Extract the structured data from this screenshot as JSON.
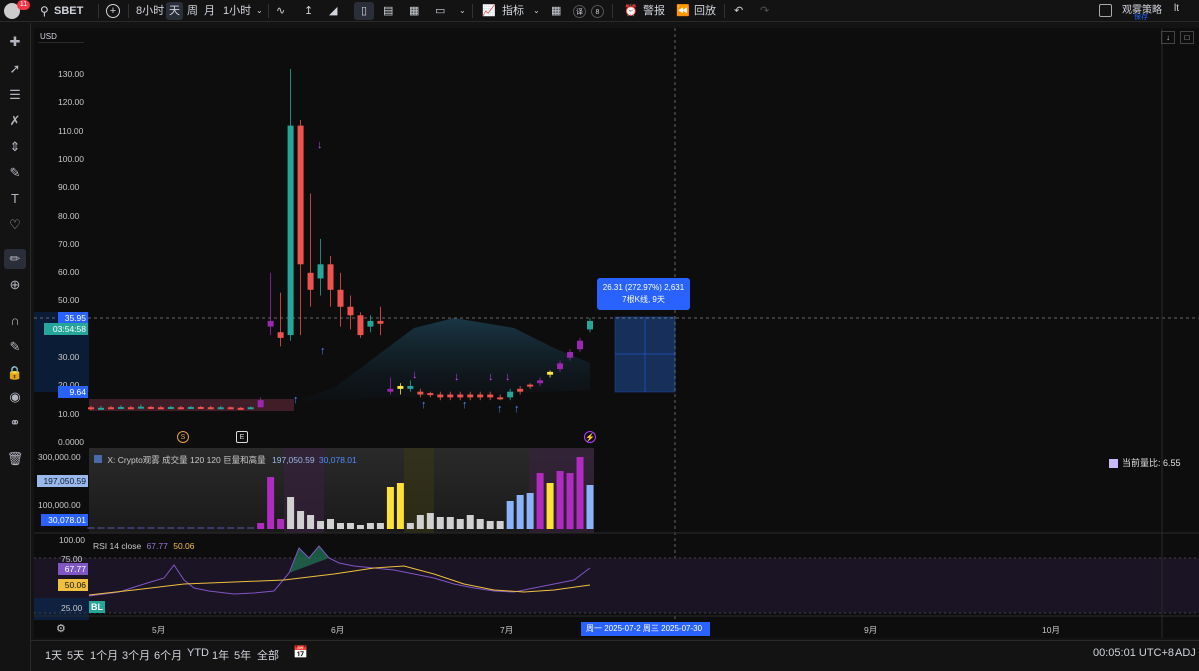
{
  "topbar": {
    "avatar_badge": "11",
    "symbol": "SBET",
    "add": "+",
    "intervals": [
      "8小时",
      "天",
      "周",
      "月",
      "1小时"
    ],
    "active_interval": "天",
    "indicators_label": "指标",
    "alerts_label": "警报",
    "replay_label": "回放",
    "layout_name": "观雾策略",
    "layout_sub": "保存",
    "small_badge_1": "译",
    "small_badge_2": "8"
  },
  "chart": {
    "currency": "USD",
    "price_ticks": [
      "130.00",
      "120.00",
      "110.00",
      "100.00",
      "90.00",
      "80.00",
      "70.00",
      "60.00",
      "50.00",
      "40.00",
      "30.00",
      "20.00",
      "10.00",
      "0.0000"
    ],
    "current_price_tag": "35.95",
    "countdown_tag": "03:54:58",
    "low_tag": "9.64",
    "measure_line1": "26.31 (272.97%) 2,631",
    "measure_line2": "7根K线, 9天",
    "event_s": "S",
    "event_e": "E",
    "volume_title": "X: Crypto观雾 成交量 120 120 巨量和高量",
    "volume_val1": "197,050.59",
    "volume_val2": "30,078.01",
    "volume_ticks": [
      "300,000.00",
      "100,000.00"
    ],
    "volume_tag1": "197,050.59",
    "volume_tag2": "30,078.01",
    "volume_ratio": "当前量比: 6.55",
    "rsi_title": "RSI 14 close",
    "rsi_val1": "67.77",
    "rsi_val2": "50.06",
    "rsi_ticks": [
      "100.00",
      "75.00",
      "25.00"
    ],
    "rsi_tag1": "67.77",
    "rsi_tag2": "50.06",
    "rsi_bl": "BL",
    "time_ticks": [
      "5月",
      "6月",
      "7月",
      "9月",
      "10月"
    ],
    "time_tag": "周一 2025-07-2 周三 2025-07-30"
  },
  "bottombar": {
    "ranges": [
      "1天",
      "5天",
      "1个月",
      "3个月",
      "6个月",
      "YTD",
      "1年",
      "5年",
      "全部"
    ],
    "clock": "00:05:01 UTC+8",
    "adj": "ADJ"
  },
  "colors": {
    "up": "#26a69a",
    "down": "#ef5350",
    "purple": "#9c27b0",
    "blue": "#2962ff",
    "yellow": "#ffeb3b",
    "accent": "#2962ff"
  },
  "chart_data": {
    "type": "candlestick",
    "price_range": [
      0,
      130
    ],
    "candles": [
      {
        "o": 4,
        "c": 4.5,
        "h": 5,
        "l": 3.5,
        "k": "d"
      },
      {
        "o": 4,
        "c": 4.3,
        "h": 5,
        "l": 3.8,
        "k": "u"
      },
      {
        "o": 4.2,
        "c": 4.5,
        "h": 5,
        "l": 4,
        "k": "d"
      },
      {
        "o": 4.5,
        "c": 4.6,
        "h": 5.2,
        "l": 4,
        "k": "u"
      },
      {
        "o": 4.5,
        "c": 4.4,
        "h": 5,
        "l": 4,
        "k": "d"
      },
      {
        "o": 4.5,
        "c": 4.7,
        "h": 5.5,
        "l": 4.2,
        "k": "u"
      },
      {
        "o": 4.6,
        "c": 4.5,
        "h": 5,
        "l": 4.2,
        "k": "d"
      },
      {
        "o": 4.5,
        "c": 4.3,
        "h": 5,
        "l": 4,
        "k": "d"
      },
      {
        "o": 4.3,
        "c": 4.6,
        "h": 5,
        "l": 4,
        "k": "u"
      },
      {
        "o": 4.5,
        "c": 4.4,
        "h": 5,
        "l": 4,
        "k": "d"
      },
      {
        "o": 4.4,
        "c": 4.6,
        "h": 5,
        "l": 4.2,
        "k": "u"
      },
      {
        "o": 4.6,
        "c": 4.5,
        "h": 5,
        "l": 4.2,
        "k": "d"
      },
      {
        "o": 4.5,
        "c": 4.4,
        "h": 5,
        "l": 4.2,
        "k": "d"
      },
      {
        "o": 4.4,
        "c": 4.5,
        "h": 5,
        "l": 4.2,
        "k": "u"
      },
      {
        "o": 4.5,
        "c": 4.3,
        "h": 4.8,
        "l": 4,
        "k": "d"
      },
      {
        "o": 4.3,
        "c": 4.2,
        "h": 4.6,
        "l": 4,
        "k": "d"
      },
      {
        "o": 4.2,
        "c": 4.5,
        "h": 4.8,
        "l": 4,
        "k": "u"
      },
      {
        "o": 4.5,
        "c": 7,
        "h": 8,
        "l": 4.4,
        "k": "p"
      },
      {
        "o": 33,
        "c": 35,
        "h": 52,
        "l": 30,
        "k": "p"
      },
      {
        "o": 31,
        "c": 29,
        "h": 45,
        "l": 26,
        "k": "d"
      },
      {
        "o": 30,
        "c": 104,
        "h": 124,
        "l": 28,
        "k": "u"
      },
      {
        "o": 104,
        "c": 55,
        "h": 106,
        "l": 30,
        "k": "d"
      },
      {
        "o": 52,
        "c": 46,
        "h": 80,
        "l": 40,
        "k": "d"
      },
      {
        "o": 50,
        "c": 55,
        "h": 64,
        "l": 44,
        "k": "u"
      },
      {
        "o": 55,
        "c": 46,
        "h": 58,
        "l": 40,
        "k": "d"
      },
      {
        "o": 46,
        "c": 40,
        "h": 52,
        "l": 33,
        "k": "d"
      },
      {
        "o": 40,
        "c": 37,
        "h": 44,
        "l": 32,
        "k": "d"
      },
      {
        "o": 37,
        "c": 30,
        "h": 38,
        "l": 29,
        "k": "d"
      },
      {
        "o": 33,
        "c": 35,
        "h": 37,
        "l": 31,
        "k": "u"
      },
      {
        "o": 35,
        "c": 34,
        "h": 40,
        "l": 30,
        "k": "d"
      },
      {
        "o": 10,
        "c": 11,
        "h": 15,
        "l": 9,
        "k": "p"
      },
      {
        "o": 11,
        "c": 12,
        "h": 13,
        "l": 9,
        "k": "y"
      },
      {
        "o": 11,
        "c": 12,
        "h": 14,
        "l": 10,
        "k": "u"
      },
      {
        "o": 10,
        "c": 9,
        "h": 11,
        "l": 8,
        "k": "d"
      },
      {
        "o": 9,
        "c": 9.5,
        "h": 10,
        "l": 8,
        "k": "d"
      },
      {
        "o": 9,
        "c": 8,
        "h": 10,
        "l": 7,
        "k": "d"
      },
      {
        "o": 9,
        "c": 8,
        "h": 10,
        "l": 7,
        "k": "d"
      },
      {
        "o": 8,
        "c": 9,
        "h": 10,
        "l": 7,
        "k": "d"
      },
      {
        "o": 9,
        "c": 8,
        "h": 10,
        "l": 7,
        "k": "d"
      },
      {
        "o": 8,
        "c": 9,
        "h": 10,
        "l": 7,
        "k": "d"
      },
      {
        "o": 9,
        "c": 8,
        "h": 10,
        "l": 7,
        "k": "d"
      },
      {
        "o": 8,
        "c": 7.5,
        "h": 9,
        "l": 7,
        "k": "d"
      },
      {
        "o": 8,
        "c": 10,
        "h": 11,
        "l": 7,
        "k": "u"
      },
      {
        "o": 10,
        "c": 11,
        "h": 12,
        "l": 9,
        "k": "d"
      },
      {
        "o": 12,
        "c": 12.5,
        "h": 13,
        "l": 11,
        "k": "d"
      },
      {
        "o": 13,
        "c": 14,
        "h": 15,
        "l": 12,
        "k": "p"
      },
      {
        "o": 16,
        "c": 17,
        "h": 17.5,
        "l": 15,
        "k": "y"
      },
      {
        "o": 18,
        "c": 20,
        "h": 21,
        "l": 17,
        "k": "p"
      },
      {
        "o": 22,
        "c": 24,
        "h": 25,
        "l": 21,
        "k": "p"
      },
      {
        "o": 25,
        "c": 28,
        "h": 29,
        "l": 24,
        "k": "p"
      },
      {
        "o": 32,
        "c": 35,
        "h": 36,
        "l": 31,
        "k": "u"
      }
    ]
  }
}
